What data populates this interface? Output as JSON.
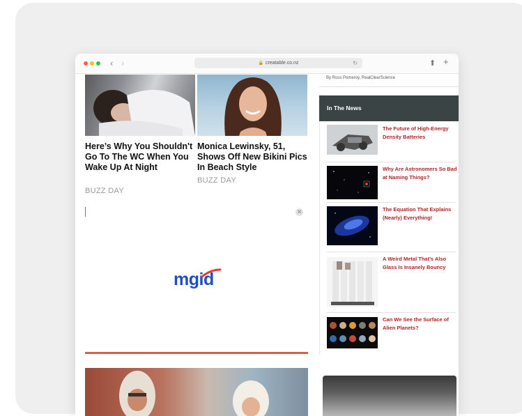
{
  "browser": {
    "url": "creatable.co.nz"
  },
  "feed": [
    {
      "headline": "Here’s Why You Shouldn't Go To The WC When You Wake Up At Night",
      "source": "BUZZ DAY"
    },
    {
      "headline": "Monica Lewinsky, 51, Shows Off New Bikini Pics In Beach Style",
      "source": "BUZZ DAY"
    }
  ],
  "ad": {
    "logo_text": "mgid",
    "accent_color": "#d9604a",
    "logo_color": "#1e4fc6"
  },
  "sidebar": {
    "byline": "By Ross Pomeroy, RealClearScience",
    "section_title": "In The News",
    "items": [
      {
        "title": "The Future of High-Energy Density Batteries"
      },
      {
        "title": "Why Are Astronomers So Bad at Naming Things?"
      },
      {
        "title": "The Equation That Explains (Nearly) Everything!"
      },
      {
        "title": "A Weird Metal That’s Also Glass Is Insanely Bouncy"
      },
      {
        "title": "Can We See the Surface of Alien Planets?"
      }
    ],
    "link_color": "#b32222",
    "header_color": "#3b4445"
  }
}
